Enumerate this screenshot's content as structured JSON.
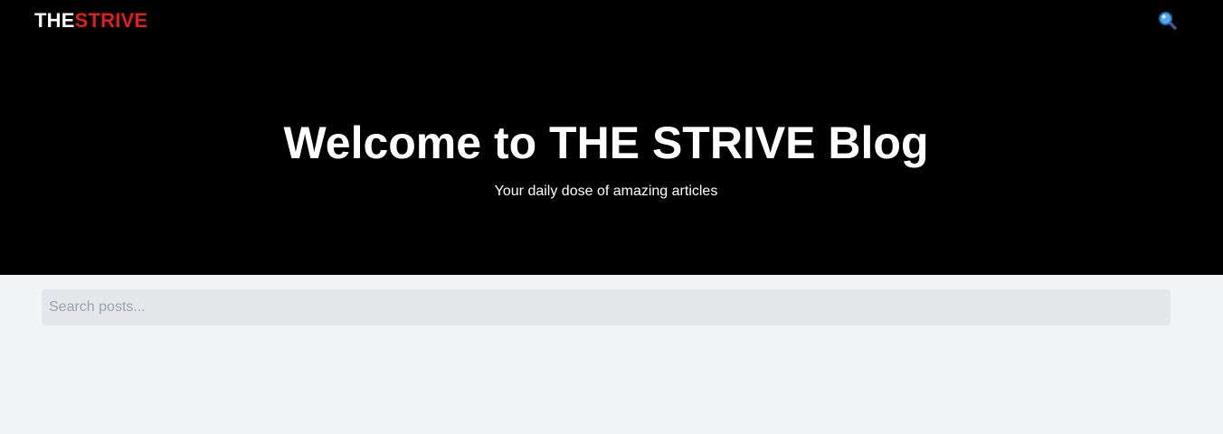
{
  "header": {
    "logo_part1": "THE",
    "logo_part2": "STRIVE",
    "search_icon": "magnifying-glass-icon"
  },
  "hero": {
    "title": "Welcome to THE STRIVE Blog",
    "subtitle": "Your daily dose of amazing articles"
  },
  "search": {
    "placeholder": "Search posts...",
    "value": ""
  },
  "colors": {
    "hero_background": "#000000",
    "brand_red": "#e11d1d",
    "page_background": "#f3f4f6",
    "input_background": "#e5e7eb"
  }
}
